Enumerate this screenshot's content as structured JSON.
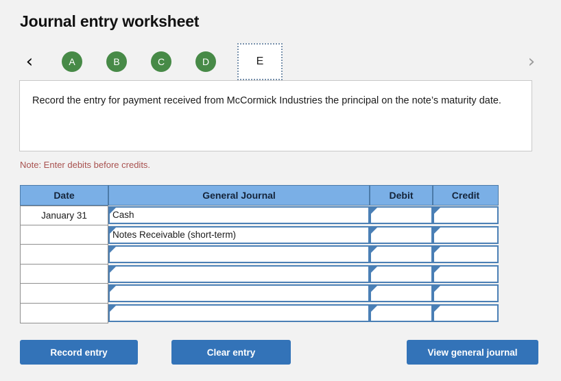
{
  "header": {
    "title": "Journal entry worksheet"
  },
  "tabs": {
    "prev_icon": "chevron-left-icon",
    "next_icon": "chevron-right-icon",
    "prev_glyph": "‹",
    "next_glyph": "›",
    "items": [
      {
        "label": "A",
        "state": "complete"
      },
      {
        "label": "B",
        "state": "complete"
      },
      {
        "label": "C",
        "state": "complete"
      },
      {
        "label": "D",
        "state": "complete"
      },
      {
        "label": "E",
        "state": "active"
      }
    ],
    "active_label": "E",
    "complete_color": "#478a47",
    "active_border_color": "#7790ab"
  },
  "instruction": {
    "text": "Record the entry for payment received from McCormick Industries the principal on the note’s maturity date."
  },
  "note": {
    "text": "Note: Enter debits before credits.",
    "color": "#a8514f"
  },
  "table": {
    "header_color": "#7aafe6",
    "columns": [
      "Date",
      "General Journal",
      "Debit",
      "Credit"
    ],
    "rows": [
      {
        "date": "January 31",
        "account": "Cash",
        "debit": "",
        "credit": ""
      },
      {
        "date": "",
        "account": "Notes Receivable (short-term)",
        "debit": "",
        "credit": ""
      },
      {
        "date": "",
        "account": "",
        "debit": "",
        "credit": ""
      },
      {
        "date": "",
        "account": "",
        "debit": "",
        "credit": ""
      },
      {
        "date": "",
        "account": "",
        "debit": "",
        "credit": ""
      },
      {
        "date": "",
        "account": "",
        "debit": "",
        "credit": ""
      }
    ]
  },
  "buttons": {
    "record": "Record entry",
    "clear": "Clear entry",
    "view": "View general journal",
    "color": "#3373b8"
  }
}
